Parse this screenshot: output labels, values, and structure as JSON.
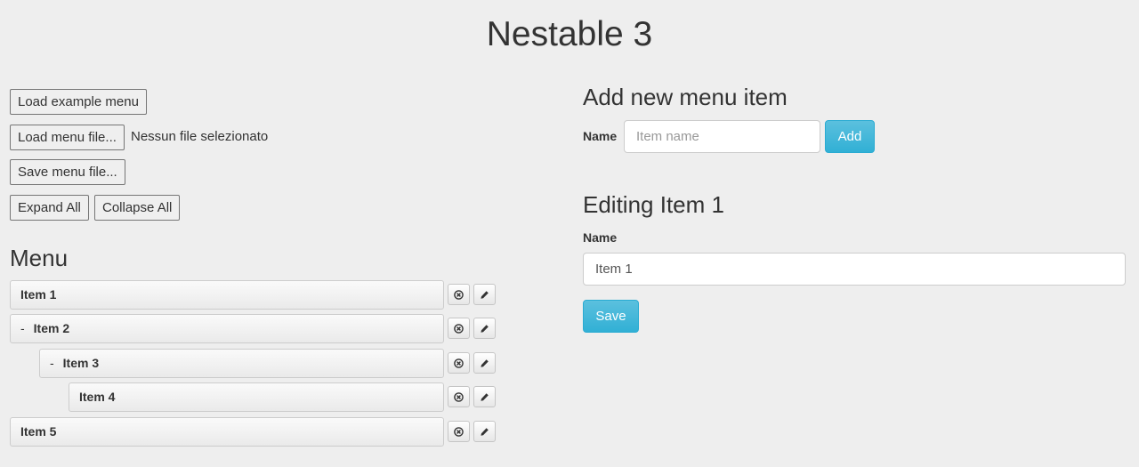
{
  "page_title": "Nestable 3",
  "controls": {
    "load_example_label": "Load example menu",
    "load_file_label": "Load menu file...",
    "file_status": "Nessun file selezionato",
    "save_file_label": "Save menu file...",
    "expand_all_label": "Expand All",
    "collapse_all_label": "Collapse All"
  },
  "menu": {
    "heading": "Menu",
    "items": [
      {
        "label": "Item 1",
        "collapse_marker": ""
      },
      {
        "label": "Item 2",
        "collapse_marker": "-"
      },
      {
        "label": "Item 3",
        "collapse_marker": "-"
      },
      {
        "label": "Item 4",
        "collapse_marker": ""
      },
      {
        "label": "Item 5",
        "collapse_marker": ""
      }
    ],
    "remove_icon": "remove-circle-icon",
    "edit_icon": "pencil-icon"
  },
  "add_form": {
    "heading": "Add new menu item",
    "name_label": "Name",
    "name_value": "",
    "name_placeholder": "Item name",
    "add_label": "Add"
  },
  "edit_form": {
    "heading": "Editing Item 1",
    "name_label": "Name",
    "name_value": "Item 1",
    "save_label": "Save"
  },
  "colors": {
    "accent": "#5bc0de",
    "background": "#eeeeee"
  }
}
